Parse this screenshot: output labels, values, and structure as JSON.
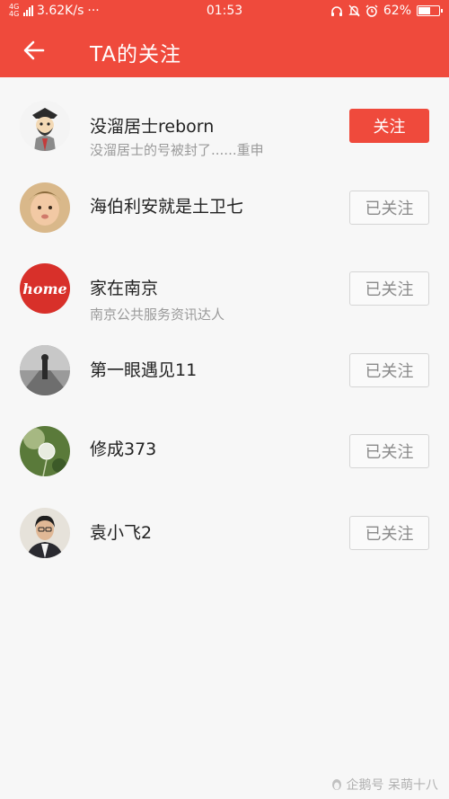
{
  "status_bar": {
    "network_type": "4G 4G",
    "net_speed": "3.62K/s",
    "dots": "···",
    "time": "01:53",
    "battery": "62%",
    "battery_level": 0.62
  },
  "header": {
    "title": "TA的关注"
  },
  "follows": [
    {
      "name": "没溜居士reborn",
      "desc": "没溜居士的号被封了......重申",
      "button": "关注",
      "followed": false,
      "avatar": "cartoon-avatar"
    },
    {
      "name": "海伯利安就是土卫七",
      "desc": "",
      "button": "已关注",
      "followed": true,
      "avatar": "child-photo-avatar"
    },
    {
      "name": "家在南京",
      "desc": "南京公共服务资讯达人",
      "button": "已关注",
      "followed": true,
      "avatar": "home-logo-avatar",
      "avatar_text": "home"
    },
    {
      "name": "第一眼遇见11",
      "desc": "",
      "button": "已关注",
      "followed": true,
      "avatar": "street-photo-avatar"
    },
    {
      "name": "修成373",
      "desc": "",
      "button": "已关注",
      "followed": true,
      "avatar": "dandelion-avatar"
    },
    {
      "name": "袁小飞2",
      "desc": "",
      "button": "已关注",
      "followed": true,
      "avatar": "man-photo-avatar"
    }
  ],
  "watermark": "企鹅号 呆萌十八",
  "colors": {
    "accent": "#ef4a3c",
    "followed_text": "#8a8a8a",
    "desc_text": "#9a9a9a"
  }
}
